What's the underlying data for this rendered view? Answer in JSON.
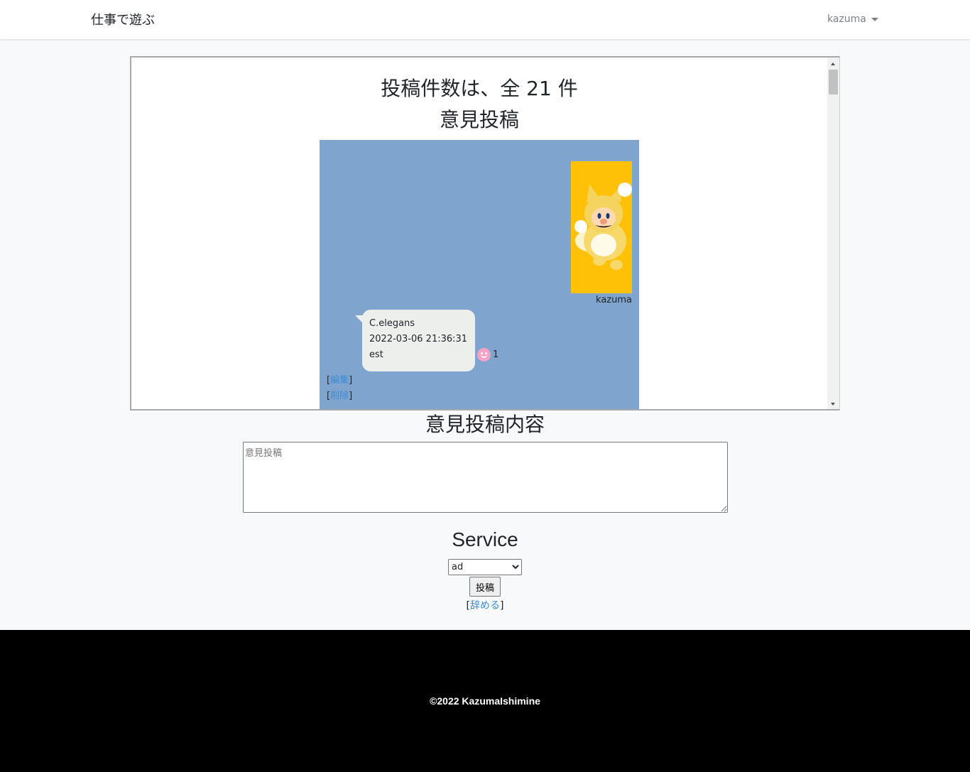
{
  "navbar": {
    "brand": "仕事で遊ぶ",
    "user": "kazuma"
  },
  "feed": {
    "count_title": "投稿件数は、全 21 件",
    "section_title": "意見投稿",
    "avatar_name": "kazuma",
    "post": {
      "author": "C.elegans",
      "timestamp": "2022-03-06 21:36:31",
      "body": "est",
      "likes": "1"
    },
    "edit_label": "編集",
    "delete_label": "削除",
    "bracket_open": "[",
    "bracket_close": "]"
  },
  "form": {
    "content_title": "意見投稿内容",
    "placeholder": "意見投稿",
    "service_title": "Service",
    "service_selected": "ad",
    "submit_label": "投稿",
    "quit_label": "辞める"
  },
  "footer": {
    "copyright": "©2022 KazumaIshimine"
  },
  "colors": {
    "chat_background": "#7fa5cf",
    "bubble": "#ecefec",
    "link": "#3d8bd4",
    "like_icon": "#f4a3c6",
    "footer": "#000000"
  },
  "icons": {
    "like": "smile-icon",
    "user_menu": "caret-down-icon"
  }
}
